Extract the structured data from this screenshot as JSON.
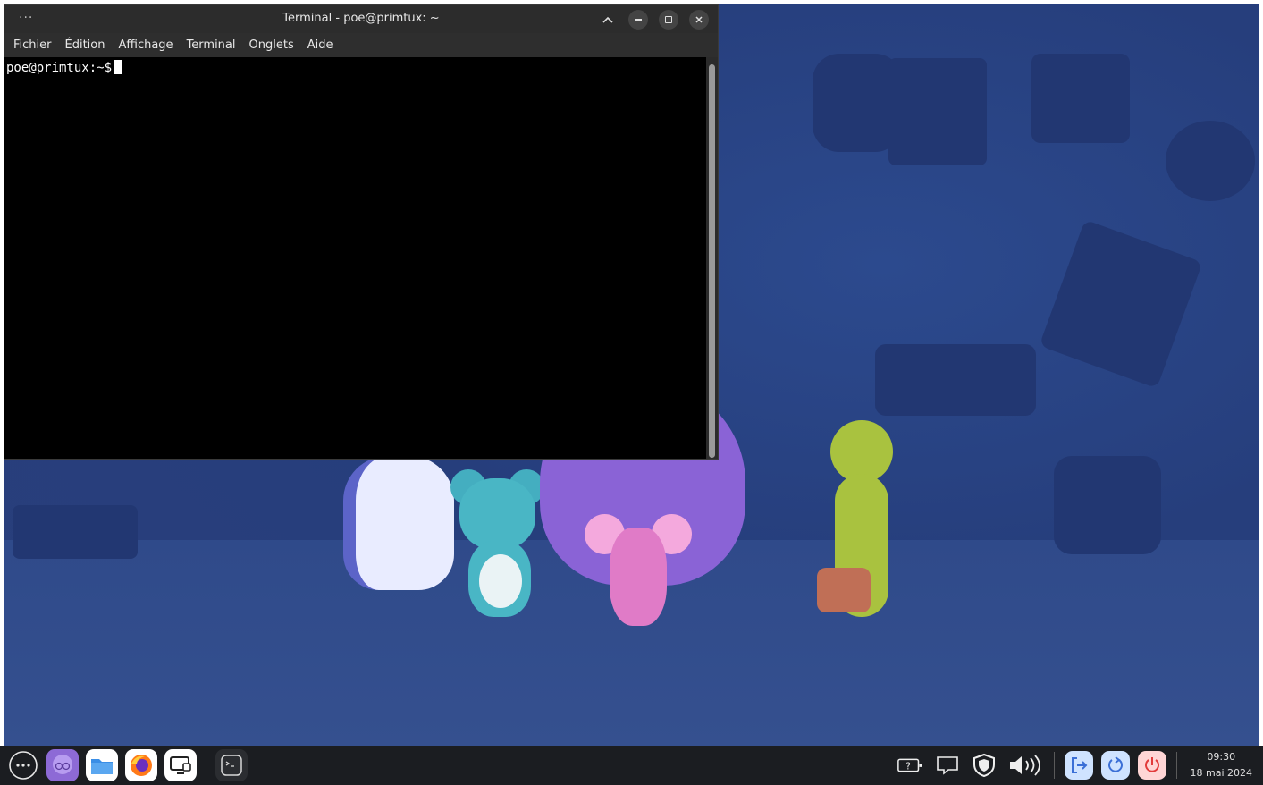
{
  "terminal": {
    "title": "Terminal - poe@primtux: ~",
    "menu_dots": "···",
    "menu": [
      "Fichier",
      "Édition",
      "Affichage",
      "Terminal",
      "Onglets",
      "Aide"
    ],
    "prompt": "poe@primtux:~$"
  },
  "window_buttons": {
    "collapse_icon": "chevron-up-icon",
    "minimize_icon": "minimize-icon",
    "maximize_icon": "maximize-icon",
    "close_icon": "close-icon"
  },
  "taskbar": {
    "left_icons": [
      "apps-menu-icon",
      "purple-mascot-icon",
      "file-manager-icon",
      "firefox-icon",
      "remote-desktop-icon",
      "terminal-icon"
    ],
    "tray_icons": [
      "keyboard-help-icon",
      "notification-icon",
      "shield-icon",
      "volume-icon"
    ],
    "action_icons": [
      "logout-icon",
      "restart-icon",
      "power-icon"
    ],
    "clock": {
      "time": "09:30",
      "date": "18 mai 2024"
    }
  },
  "colors": {
    "desktop_bg": "#263e7c",
    "taskbar_bg": "#1b1d21",
    "terminal_bg": "#000000",
    "logout_bg": "#cfe3ff",
    "restart_bg": "#cfe3ff",
    "power_bg": "#ffd6d6"
  }
}
